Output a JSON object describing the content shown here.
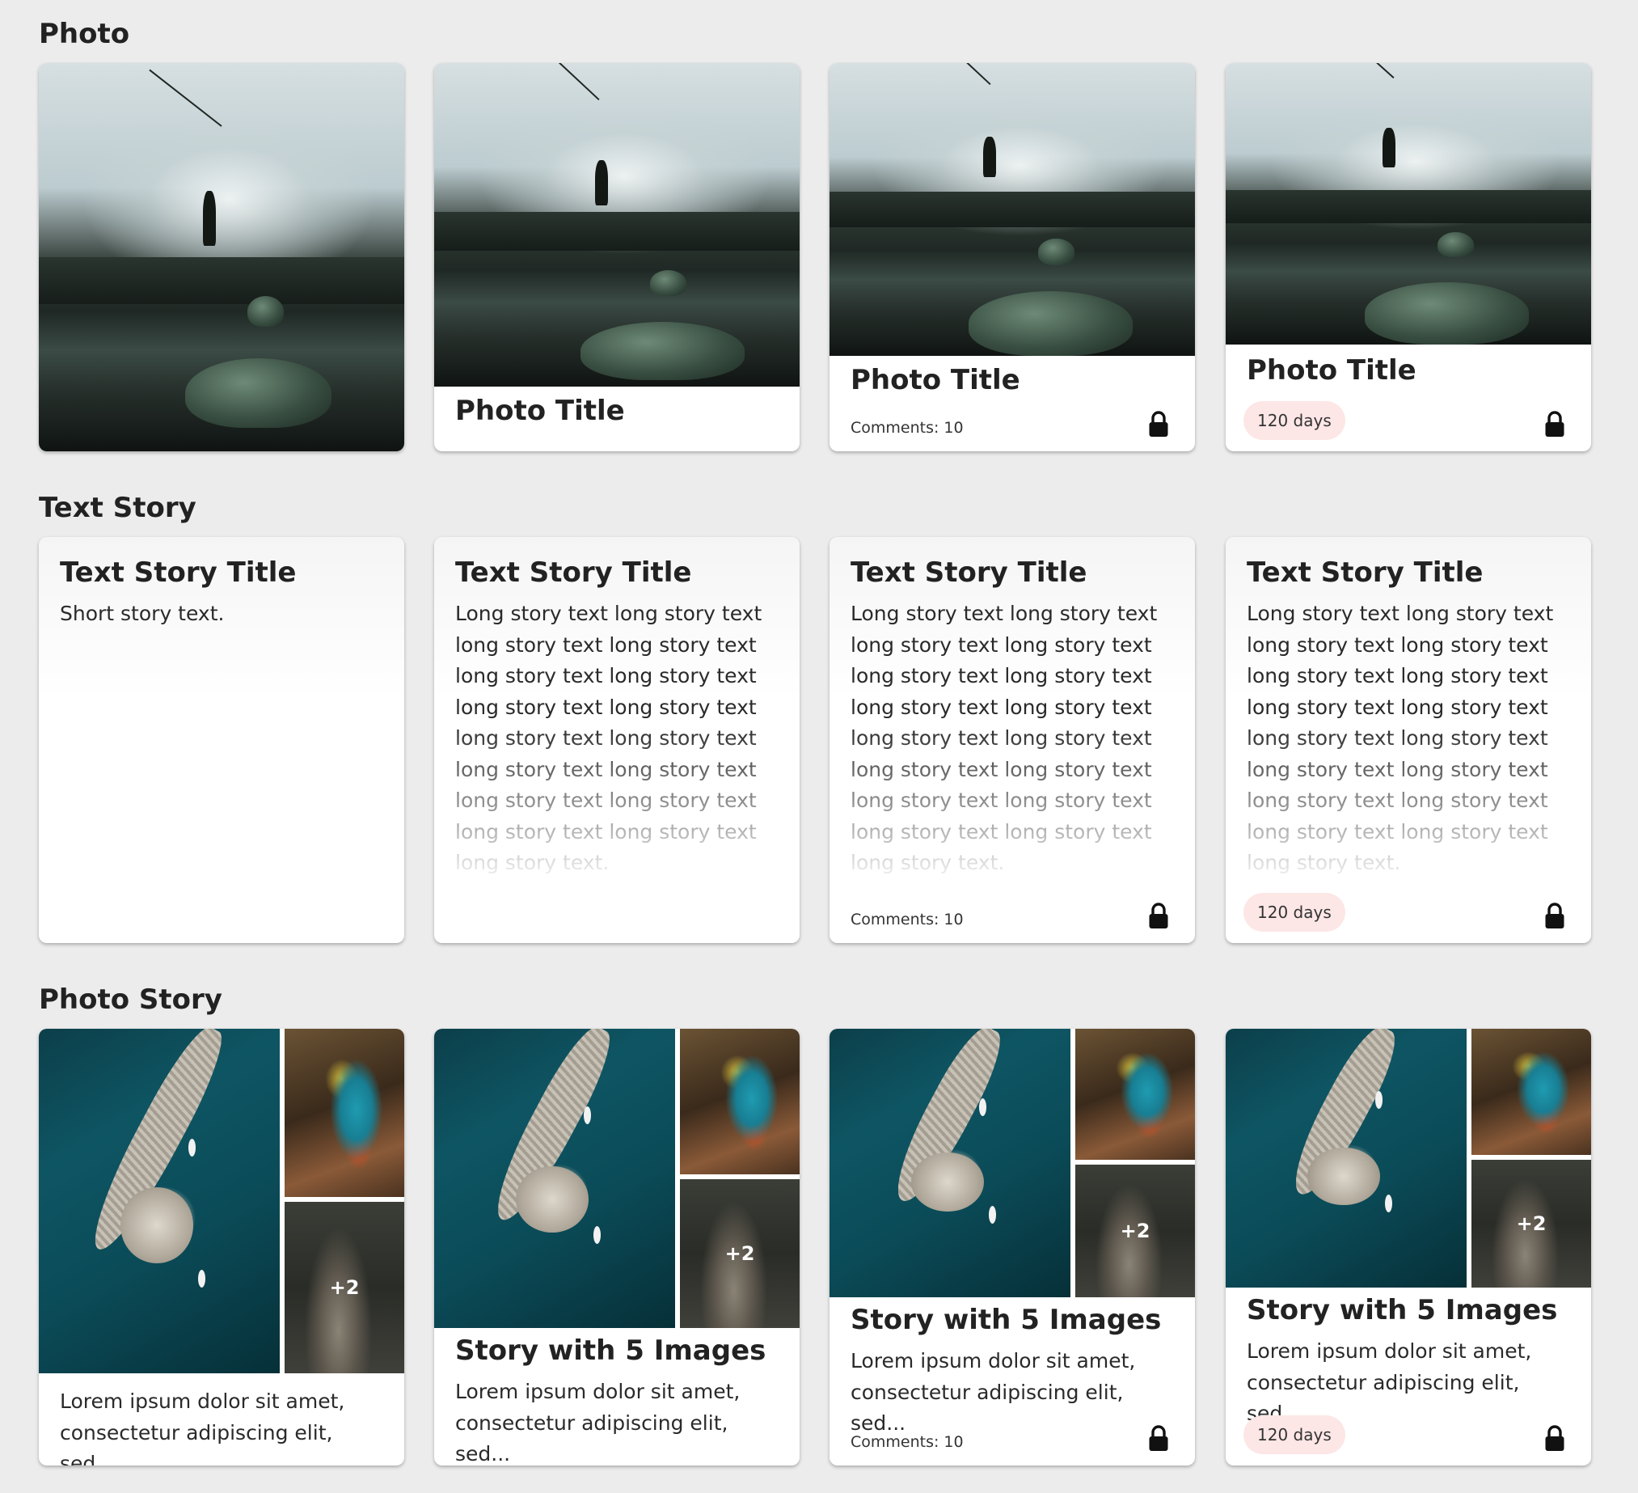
{
  "sections": {
    "photo": "Photo",
    "text_story": "Text Story",
    "photo_story": "Photo Story"
  },
  "photo_cards": [
    {
      "title": ""
    },
    {
      "title": "Photo Title"
    },
    {
      "title": "Photo Title",
      "comments": "Comments: 10"
    },
    {
      "title": "Photo Title",
      "badge": "120 days"
    }
  ],
  "text_cards": [
    {
      "title": "Text Story Title",
      "text": "Short story text."
    },
    {
      "title": "Text Story Title",
      "text": "Long story text long story text long story text long story text long story text long story text long story text long story text long story text long story text long story text long story text long story text long story text long story text long story text long story text."
    },
    {
      "title": "Text Story Title",
      "text": "Long story text long story text long story text long story text long story text long story text long story text long story text long story text long story text long story text long story text long story text long story text long story text long story text long story text.",
      "comments": "Comments: 10"
    },
    {
      "title": "Text Story Title",
      "text": "Long story text long story text long story text long story text long story text long story text long story text long story text long story text long story text long story text long story text long story text long story text long story text long story text long story text.",
      "badge": "120 days"
    }
  ],
  "story_cards": [
    {
      "title": "",
      "text": "Lorem ipsum dolor sit amet, consectetur adipiscing elit, sed...",
      "more": "+2"
    },
    {
      "title": "Story with 5 Images",
      "text": "Lorem ipsum dolor sit amet, consectetur adipiscing elit, sed...",
      "more": "+2"
    },
    {
      "title": "Story with 5 Images",
      "text": "Lorem ipsum dolor sit amet, consectetur adipiscing elit, sed...",
      "more": "+2",
      "comments": "Comments: 10"
    },
    {
      "title": "Story with 5 Images",
      "text": "Lorem ipsum dolor sit amet, consectetur adipiscing elit, sed...",
      "more": "+2",
      "badge": "120 days"
    }
  ],
  "icons": {
    "lock": "lock-icon"
  },
  "colors": {
    "background": "#ececec",
    "badge_bg": "#fde6e6",
    "card_bg": "#ffffff"
  }
}
